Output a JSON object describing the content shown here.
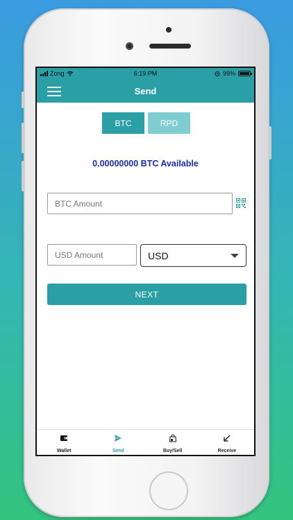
{
  "status": {
    "carrier": "Zong",
    "time": "6:19 PM",
    "battery": "99%"
  },
  "header": {
    "title": "Send"
  },
  "currency_tabs": [
    {
      "label": "BTC",
      "active": true
    },
    {
      "label": "RPD",
      "active": false
    }
  ],
  "balance": {
    "text": "0.00000000 BTC Available"
  },
  "form": {
    "btc_amount_placeholder": "BTC Amount",
    "usd_amount_placeholder": "USD Amount",
    "currency_selected": "USD",
    "next_label": "NEXT"
  },
  "tabbar": {
    "items": [
      {
        "label": "Wallet",
        "icon": "wallet-icon"
      },
      {
        "label": "Send",
        "icon": "send-icon",
        "active": true
      },
      {
        "label": "Buy/Sell",
        "icon": "bag-icon"
      },
      {
        "label": "Receive",
        "icon": "receive-icon"
      }
    ]
  },
  "colors": {
    "primary": "#2aa0a6",
    "primary_light": "#7fcdd1",
    "balance_text": "#1a2bb0"
  }
}
